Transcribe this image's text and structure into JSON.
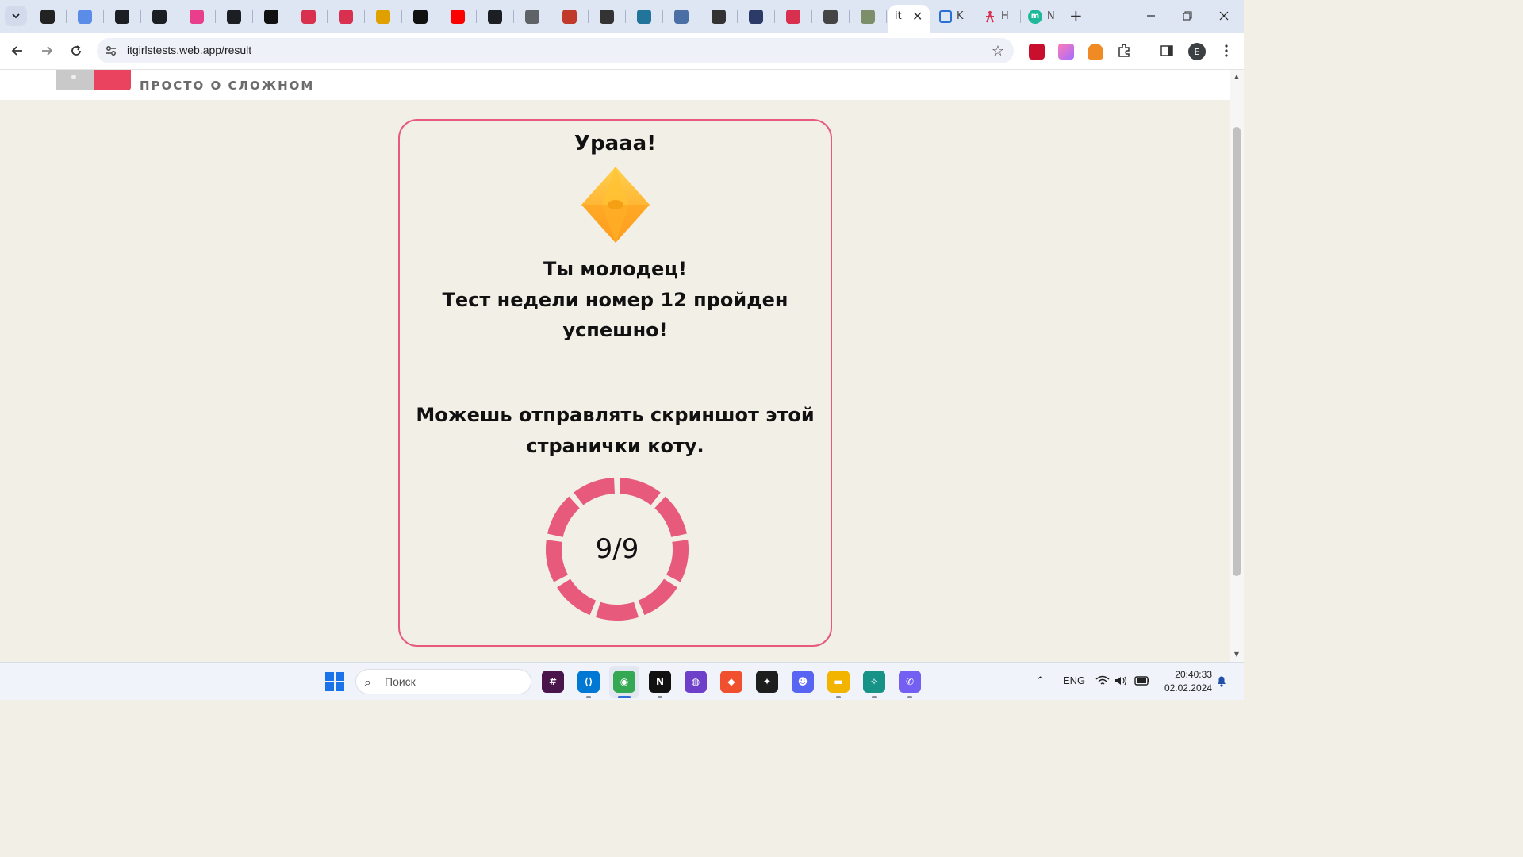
{
  "browser": {
    "pinned_tabs": [
      {
        "icon": "rs-icon",
        "color": "#222222"
      },
      {
        "icon": "translate-icon",
        "color": "#5b8de8"
      },
      {
        "icon": "github-icon",
        "color": "#1b1f23"
      },
      {
        "icon": "github-icon",
        "color": "#1b1f23"
      },
      {
        "icon": "app-icon",
        "color": "#e83e8c"
      },
      {
        "icon": "github-icon",
        "color": "#1b1f23"
      },
      {
        "icon": "angular-icon",
        "color": "#111111"
      },
      {
        "icon": "itgirls-icon",
        "color": "#d9304f"
      },
      {
        "icon": "itgirls-icon",
        "color": "#d9304f"
      },
      {
        "icon": "pencil-icon",
        "color": "#e0a100"
      },
      {
        "icon": "angular-icon",
        "color": "#111111"
      },
      {
        "icon": "youtube-icon",
        "color": "#ff0000"
      },
      {
        "icon": "github-icon",
        "color": "#1b1f23"
      },
      {
        "icon": "globe-icon",
        "color": "#5f6368"
      },
      {
        "icon": "banner-icon",
        "color": "#c0392b"
      },
      {
        "icon": "compass-icon",
        "color": "#333333"
      },
      {
        "icon": "wordpress-icon",
        "color": "#21759b"
      },
      {
        "icon": "laptop-icon",
        "color": "#4a6fa5"
      },
      {
        "icon": "shield-icon",
        "color": "#333333"
      },
      {
        "icon": "bot-icon",
        "color": "#2b3a67"
      },
      {
        "icon": "itgirls-icon",
        "color": "#d9304f"
      },
      {
        "icon": "traffic-light-icon",
        "color": "#444444"
      },
      {
        "icon": "photo-icon",
        "color": "#7c8f6a"
      }
    ],
    "active_tab": {
      "label": "it",
      "close": "✕"
    },
    "extra_tabs": [
      {
        "label": "K",
        "icon": "kanban-icon",
        "color": "#2a6fd6"
      },
      {
        "label": "H",
        "icon": "itgirls-icon",
        "color": "#d9304f"
      },
      {
        "label": "N",
        "icon": "m-icon",
        "color": "#1fb89b"
      }
    ],
    "new_tab": "+",
    "url": "itgirlstests.web.app/result",
    "profile_initial": "E"
  },
  "site": {
    "logo_tagline": "ПРОСТО О СЛОЖНОМ"
  },
  "result": {
    "title": "Урааа!",
    "message_lines": [
      "Ты молодец!",
      "Тест недели номер 12 пройден",
      "успешно!"
    ],
    "share_lines": [
      "Можешь отправлять скриншот этой",
      "странички коту."
    ],
    "score": "9/9",
    "correct": 9,
    "total": 9,
    "accent_color": "#e75a7c"
  },
  "taskbar": {
    "search_placeholder": "Поиск",
    "language": "ENG",
    "time": "20:40:33",
    "date": "02.02.2024",
    "apps": [
      {
        "name": "slack-icon",
        "color": "#4a154b"
      },
      {
        "name": "vscode-icon",
        "color": "#0078d4"
      },
      {
        "name": "chrome-icon",
        "color": "#34a853"
      },
      {
        "name": "notion-icon",
        "color": "#111111"
      },
      {
        "name": "github-desktop-icon",
        "color": "#6e40c9"
      },
      {
        "name": "git-icon",
        "color": "#f1502f"
      },
      {
        "name": "figma-icon",
        "color": "#1e1e1e"
      },
      {
        "name": "discord-icon",
        "color": "#5865f2"
      },
      {
        "name": "folder-icon",
        "color": "#f3b400"
      },
      {
        "name": "gitkraken-icon",
        "color": "#179287"
      },
      {
        "name": "viber-icon",
        "color": "#7360f2"
      }
    ]
  }
}
